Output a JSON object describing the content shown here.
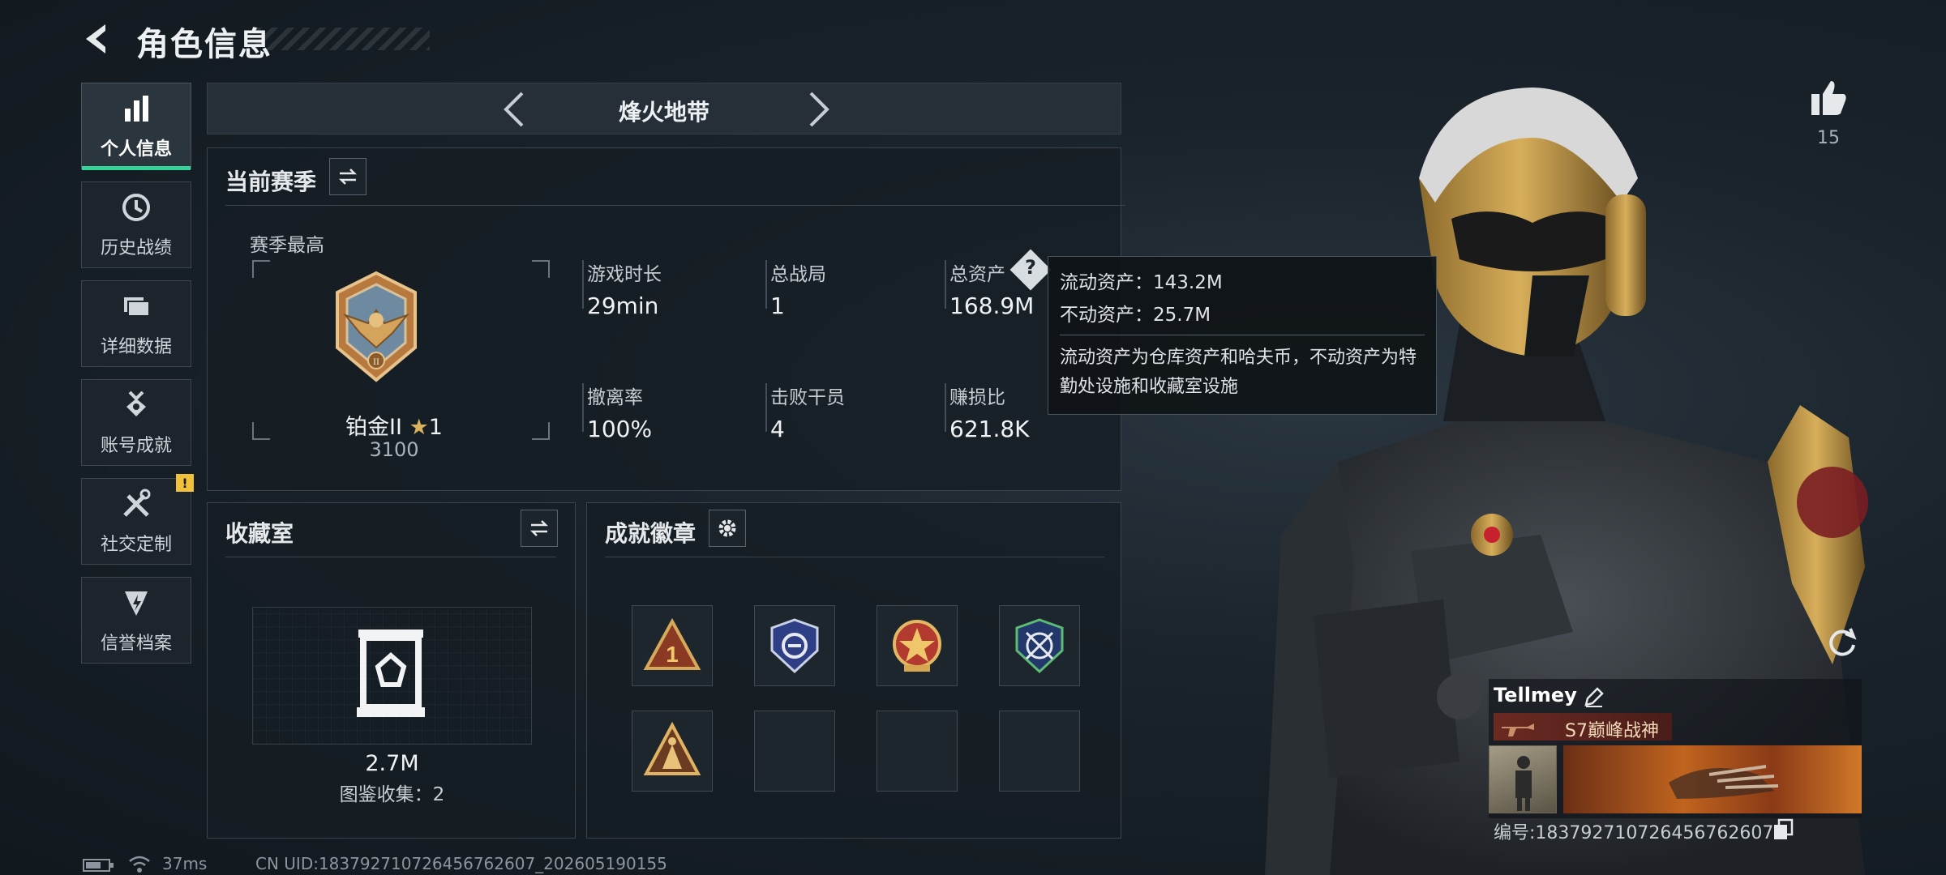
{
  "header": {
    "title": "角色信息"
  },
  "sidebar": {
    "items": [
      {
        "label": "个人信息",
        "icon": "bar-chart-icon",
        "active": true
      },
      {
        "label": "历史战绩",
        "icon": "clock-icon"
      },
      {
        "label": "详细数据",
        "icon": "folder-icon"
      },
      {
        "label": "账号成就",
        "icon": "medal-icon"
      },
      {
        "label": "社交定制",
        "icon": "tools-icon",
        "badge": "!"
      },
      {
        "label": "信誉档案",
        "icon": "shield-lightning-icon"
      }
    ]
  },
  "mode_selector": {
    "title": "烽火地带"
  },
  "season": {
    "title": "当前赛季",
    "best_label": "赛季最高",
    "rank_name": "铂金II",
    "rank_stars": "1",
    "rank_score": "3100",
    "stats": [
      {
        "label": "游戏时长",
        "value": "29min"
      },
      {
        "label": "总战局",
        "value": "1"
      },
      {
        "label": "总资产",
        "value": "168.9M",
        "help": "?"
      },
      {
        "label": "撤离率",
        "value": "100%"
      },
      {
        "label": "击败干员",
        "value": "4"
      },
      {
        "label": "赚损比",
        "value": "621.8K"
      }
    ]
  },
  "tooltip": {
    "liquid": "流动资产：143.2M",
    "fixed": "不动资产：25.7M",
    "description": "流动资产为仓库资产和哈夫币，不动资产为特勤处设施和收藏室设施"
  },
  "collection": {
    "title": "收藏室",
    "value": "2.7M",
    "gallery": "图鉴收集：2"
  },
  "achievements": {
    "title": "成就徽章"
  },
  "likes": {
    "count": "15"
  },
  "player_card": {
    "name": "Tellmey",
    "title": "S7巅峰战神",
    "id_text": "编号:183792710726456762607"
  },
  "footer": {
    "ping": "37ms",
    "uid": "CN UID:183792710726456762607_202605190155"
  },
  "colors": {
    "accent": "#35d39a",
    "warning": "#f0c23a",
    "panel_border": "#3a444e"
  }
}
